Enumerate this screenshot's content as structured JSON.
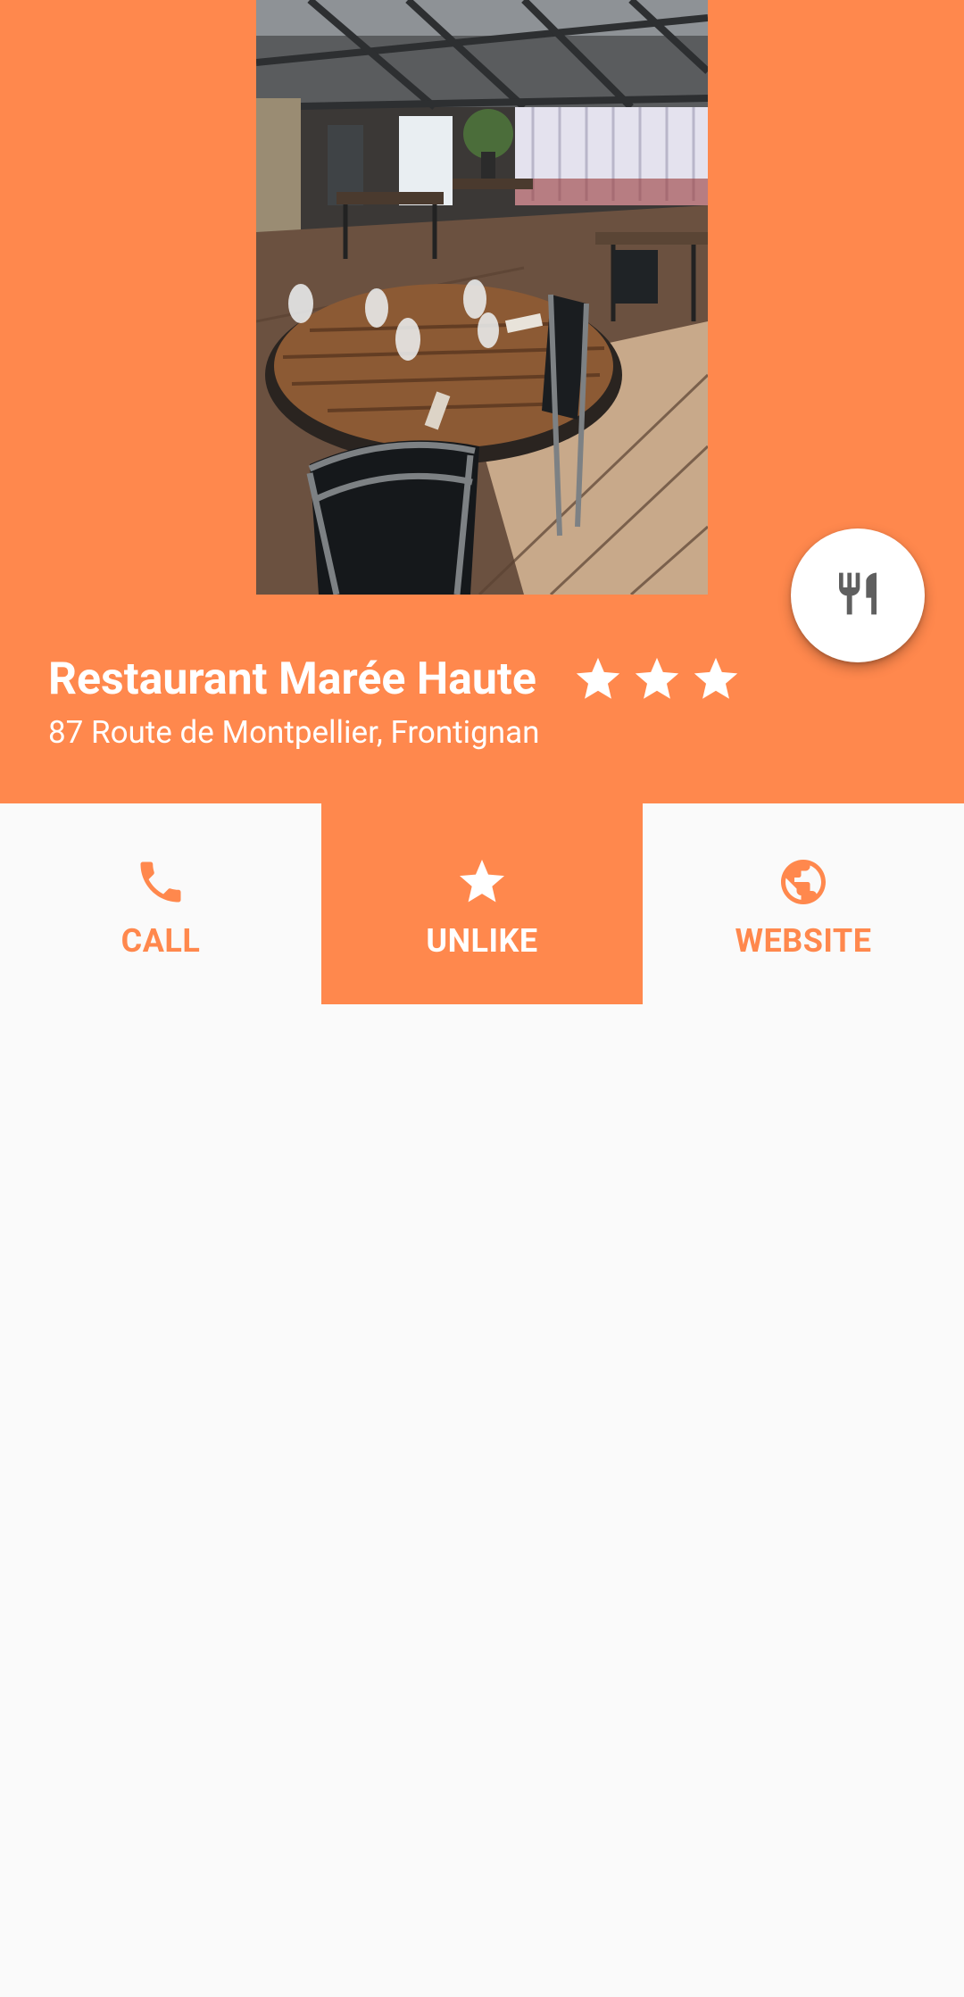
{
  "restaurant": {
    "name": "Restaurant Marée Haute",
    "address": "87 Route de Montpellier, Frontignan",
    "rating_stars": 3
  },
  "actions": [
    {
      "label": "CALL",
      "icon": "phone-icon",
      "active": false
    },
    {
      "label": "UNLIKE",
      "icon": "star-icon",
      "active": true
    },
    {
      "label": "WEBSITE",
      "icon": "globe-icon",
      "active": false
    }
  ],
  "fab": {
    "icon": "restaurant-icon"
  },
  "colors": {
    "primary": "#ff884d",
    "background": "#fafafa",
    "fab_icon": "#5f5f5f"
  }
}
